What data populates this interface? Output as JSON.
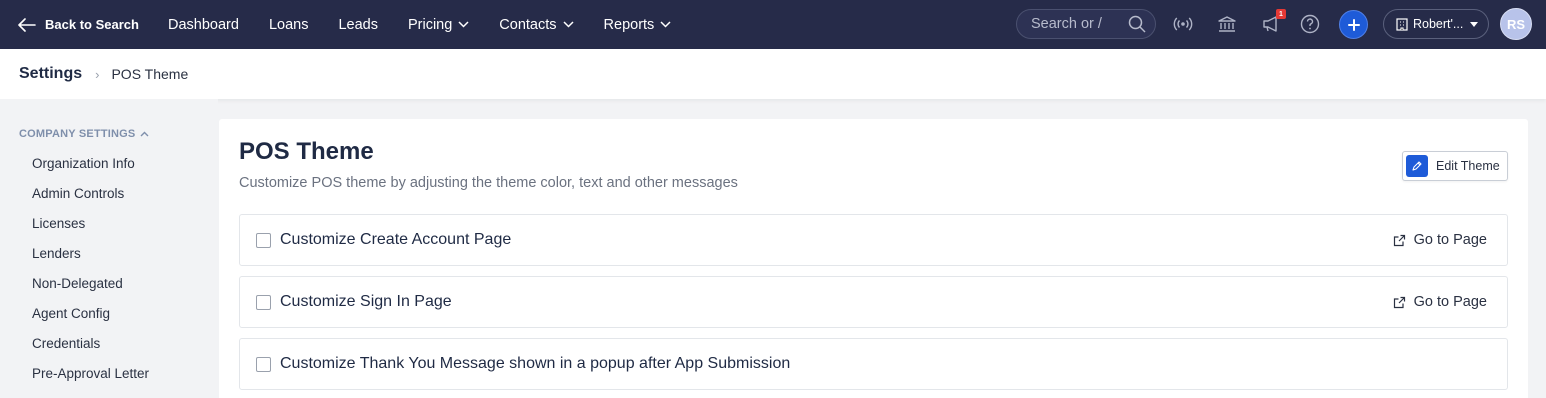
{
  "topnav": {
    "back_label": "Back to Search",
    "items": [
      {
        "label": "Dashboard",
        "has_dropdown": false
      },
      {
        "label": "Loans",
        "has_dropdown": false
      },
      {
        "label": "Leads",
        "has_dropdown": false
      },
      {
        "label": "Pricing",
        "has_dropdown": true
      },
      {
        "label": "Contacts",
        "has_dropdown": true
      },
      {
        "label": "Reports",
        "has_dropdown": true
      }
    ],
    "search_placeholder": "Search or /",
    "notification_count": "1",
    "user_label": "Robert'...",
    "avatar_initials": "RS",
    "icons": [
      "broadcast-icon",
      "bank-icon",
      "megaphone-icon",
      "help-icon",
      "plus-icon",
      "building-icon"
    ]
  },
  "breadcrumb": {
    "root": "Settings",
    "separator": "›",
    "current": "POS Theme"
  },
  "sidebar": {
    "section_title": "COMPANY SETTINGS",
    "items": [
      "Organization Info",
      "Admin Controls",
      "Licenses",
      "Lenders",
      "Non-Delegated",
      "Agent Config",
      "Credentials",
      "Pre-Approval Letter"
    ]
  },
  "main": {
    "title": "POS Theme",
    "subtitle": "Customize POS theme by adjusting the theme color, text and other messages",
    "edit_button": "Edit Theme",
    "rows": [
      {
        "label": "Customize Create Account Page",
        "action": "Go to Page",
        "checked": false
      },
      {
        "label": "Customize Sign In Page",
        "action": "Go to Page",
        "checked": false
      },
      {
        "label": "Customize Thank You Message shown in a popup after App Submission",
        "action": "",
        "checked": false
      }
    ]
  },
  "colors": {
    "nav_bg": "#262b49",
    "accent": "#1e5bd8",
    "badge": "#e53935",
    "page_bg": "#f2f3f5"
  }
}
